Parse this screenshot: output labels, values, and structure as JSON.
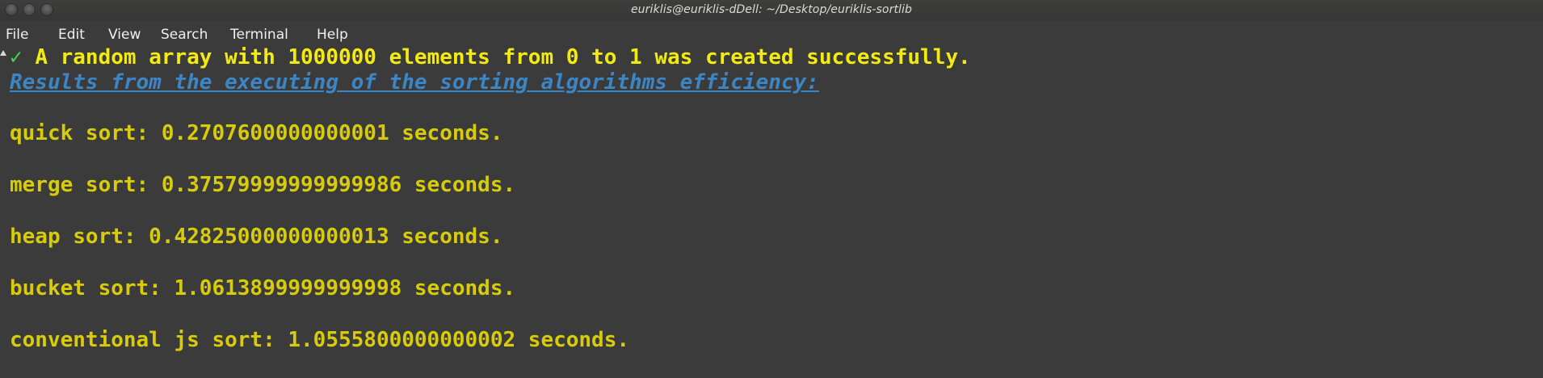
{
  "window": {
    "title": "euriklis@euriklis-dDell: ~/Desktop/euriklis-sortlib"
  },
  "menu": {
    "items": [
      "File",
      "Edit",
      "View",
      "Search",
      "Terminal",
      "Help"
    ]
  },
  "terminal": {
    "success_icon": "✓",
    "success_message": "A random array with 1000000 elements from 0 to 1 was created successfully.",
    "heading": "Results from the executing of the sorting algorithms efficiency:",
    "results": [
      {
        "text": "quick sort: 0.2707600000000001 seconds."
      },
      {
        "text": "merge sort: 0.37579999999999986 seconds."
      },
      {
        "text": "heap sort: 0.42825000000000013 seconds."
      },
      {
        "text": "bucket sort: 1.0613899999999998 seconds."
      },
      {
        "text": "conventional js sort: 1.0555800000000002 seconds."
      }
    ]
  },
  "colors": {
    "background": "#3b3b3c",
    "output_text": "#d8cc0a",
    "success_text": "#f2ea11",
    "check_mark": "#4bd44b",
    "heading": "#3d86c6"
  }
}
